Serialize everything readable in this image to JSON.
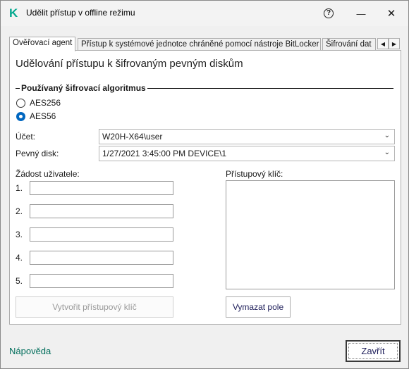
{
  "window": {
    "title": "Udělit přístup v offline režimu",
    "app_icon": "kaspersky-k",
    "help_glyph": "?",
    "minimize_glyph": "—",
    "close_glyph": "✕"
  },
  "tabs": [
    {
      "label": "Ověřovací agent",
      "active": true
    },
    {
      "label": "Přístup k systémové jednotce chráněné pomocí nástroje BitLocker",
      "active": false
    },
    {
      "label": "Šifrování dat",
      "active": false
    }
  ],
  "tab_scroll": {
    "left": "◀",
    "right": "▶"
  },
  "panel": {
    "heading": "Udělování přístupu k šifrovaným pevným diskům",
    "algorithm_group": "Používaný šifrovací algoritmus",
    "algorithms": [
      {
        "label": "AES256",
        "checked": false
      },
      {
        "label": "AES56",
        "checked": true
      }
    ],
    "account_label": "Účet:",
    "account_value": "W20H-X64\\user",
    "disk_label": "Pevný disk:",
    "disk_value": "1/27/2021 3:45:00 PM  DEVICE\\1",
    "user_request_label": "Žádost uživatele:",
    "request_rows": [
      {
        "num": "1.",
        "value": ""
      },
      {
        "num": "2.",
        "value": ""
      },
      {
        "num": "3.",
        "value": ""
      },
      {
        "num": "4.",
        "value": ""
      },
      {
        "num": "5.",
        "value": ""
      }
    ],
    "access_key_label": "Přístupový klíč:",
    "access_key_value": "",
    "create_key_button": "Vytvořit přístupový klíč",
    "clear_button": "Vymazat pole"
  },
  "footer": {
    "help_link": "Nápověda",
    "close_button": "Zavřít"
  },
  "colors": {
    "accent": "#0067c0",
    "link": "#006d5b",
    "brand": "#00a88e"
  }
}
